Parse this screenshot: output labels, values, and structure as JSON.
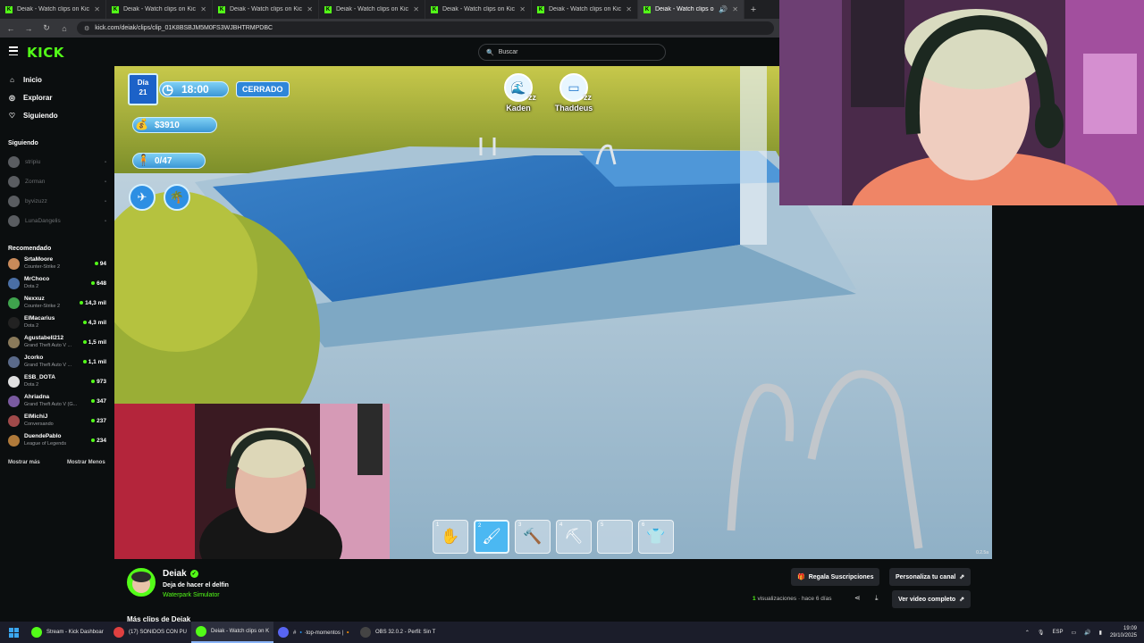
{
  "browser": {
    "tabs": [
      {
        "label": "Deiak - Watch clips on Kick",
        "active": false
      },
      {
        "label": "Deiak - Watch clips on Kick",
        "active": false
      },
      {
        "label": "Deiak - Watch clips on Kick",
        "active": false
      },
      {
        "label": "Deiak - Watch clips on Kick",
        "active": false
      },
      {
        "label": "Deiak - Watch clips on Kick",
        "active": false
      },
      {
        "label": "Deiak - Watch clips on Kick",
        "active": false
      },
      {
        "label": "Deiak - Watch clips on Kick",
        "active": true
      }
    ],
    "url": "kick.com/deiak/clips/clip_01K8BSBJM5M0FS3WJBHTRMPDBC"
  },
  "header": {
    "logo": "KICK",
    "search_placeholder": "Buscar"
  },
  "sidebar": {
    "nav": [
      {
        "label": "Inicio",
        "icon": "home-icon"
      },
      {
        "label": "Explorar",
        "icon": "compass-icon"
      },
      {
        "label": "Siguiendo",
        "icon": "heart-icon"
      }
    ],
    "following_title": "Siguiendo",
    "following": [
      {
        "name": "stripiu"
      },
      {
        "name": "Zorman"
      },
      {
        "name": "byvizuzz"
      },
      {
        "name": "LunaDangelis"
      }
    ],
    "recommended_title": "Recomendado",
    "recommended": [
      {
        "name": "SrtaMoore",
        "game": "Counter-Strike 2",
        "viewers": "94",
        "color": "#c98a5a"
      },
      {
        "name": "MrChoco",
        "game": "Dota 2",
        "viewers": "648",
        "color": "#4a6fa5"
      },
      {
        "name": "Nexxuz",
        "game": "Counter-Strike 2",
        "viewers": "14,3 mil",
        "color": "#3fa34d"
      },
      {
        "name": "ElMacarius",
        "game": "Dota 2",
        "viewers": "4,3 mil",
        "color": "#222222"
      },
      {
        "name": "Agustabell212",
        "game": "Grand Theft Auto V ...",
        "viewers": "1,5 mil",
        "color": "#8a7a5a"
      },
      {
        "name": "Jcorko",
        "game": "Grand Theft Auto V ...",
        "viewers": "1,1 mil",
        "color": "#5a6a8a"
      },
      {
        "name": "ESB_DOTA",
        "game": "Dota 2",
        "viewers": "973",
        "color": "#e0e0e0"
      },
      {
        "name": "Ahriadna",
        "game": "Grand Theft Auto V (G...",
        "viewers": "347",
        "color": "#7a5aa0"
      },
      {
        "name": "ElMichiJ",
        "game": "Conversando",
        "viewers": "237",
        "color": "#a04a4a"
      },
      {
        "name": "DuendePablo",
        "game": "League of Legends",
        "viewers": "234",
        "color": "#b07a3a"
      }
    ],
    "show_more": "Mostrar más",
    "show_less": "Mostrar Menos"
  },
  "game_hud": {
    "day_label": "Día",
    "day_number": "21",
    "time": "18:00",
    "status": "CERRADO",
    "money": "$3910",
    "visitors": "0/47",
    "npcs": [
      "Kaden",
      "Thaddeus"
    ],
    "hotbar": [
      {
        "num": "1",
        "icon": "hand-icon"
      },
      {
        "num": "2",
        "icon": "brush-icon"
      },
      {
        "num": "3",
        "icon": "hammer-icon"
      },
      {
        "num": "4",
        "icon": "shovel-icon"
      },
      {
        "num": "5",
        "icon": "empty-slot"
      },
      {
        "num": "6",
        "icon": "shirt-icon"
      }
    ],
    "selected_slot": 2,
    "version": "0.2.5a"
  },
  "clip": {
    "channel": "Deiak",
    "title": "Deja de hacer el delfin",
    "game": "Waterpark Simulator",
    "views_count": "1",
    "views_label": "visualizaciones",
    "age": "hace 6 días",
    "gift_button": "Regala Suscripciones",
    "customize_button": "Personaliza tu canal",
    "full_video_button": "Ver video completo",
    "more_clips": "Más clips de Deiak"
  },
  "taskbar": {
    "items": [
      {
        "label": "Stream - Kick Dashboar",
        "color": "#53fc18",
        "active": false
      },
      {
        "label": "(17) SONIDOS CON PU",
        "color": "#e04040",
        "active": false
      },
      {
        "label": "Deiak - Watch clips on K",
        "color": "#53fc18",
        "active": true
      },
      {
        "label": "# 🔹·top-momentos | 🔸",
        "color": "#5865f2",
        "active": false
      },
      {
        "label": "OBS 32.0.2 - Perfil: Sin T",
        "color": "#444",
        "active": false
      }
    ],
    "lang": "ESP",
    "time": "19:09",
    "date": "29/10/2025"
  }
}
